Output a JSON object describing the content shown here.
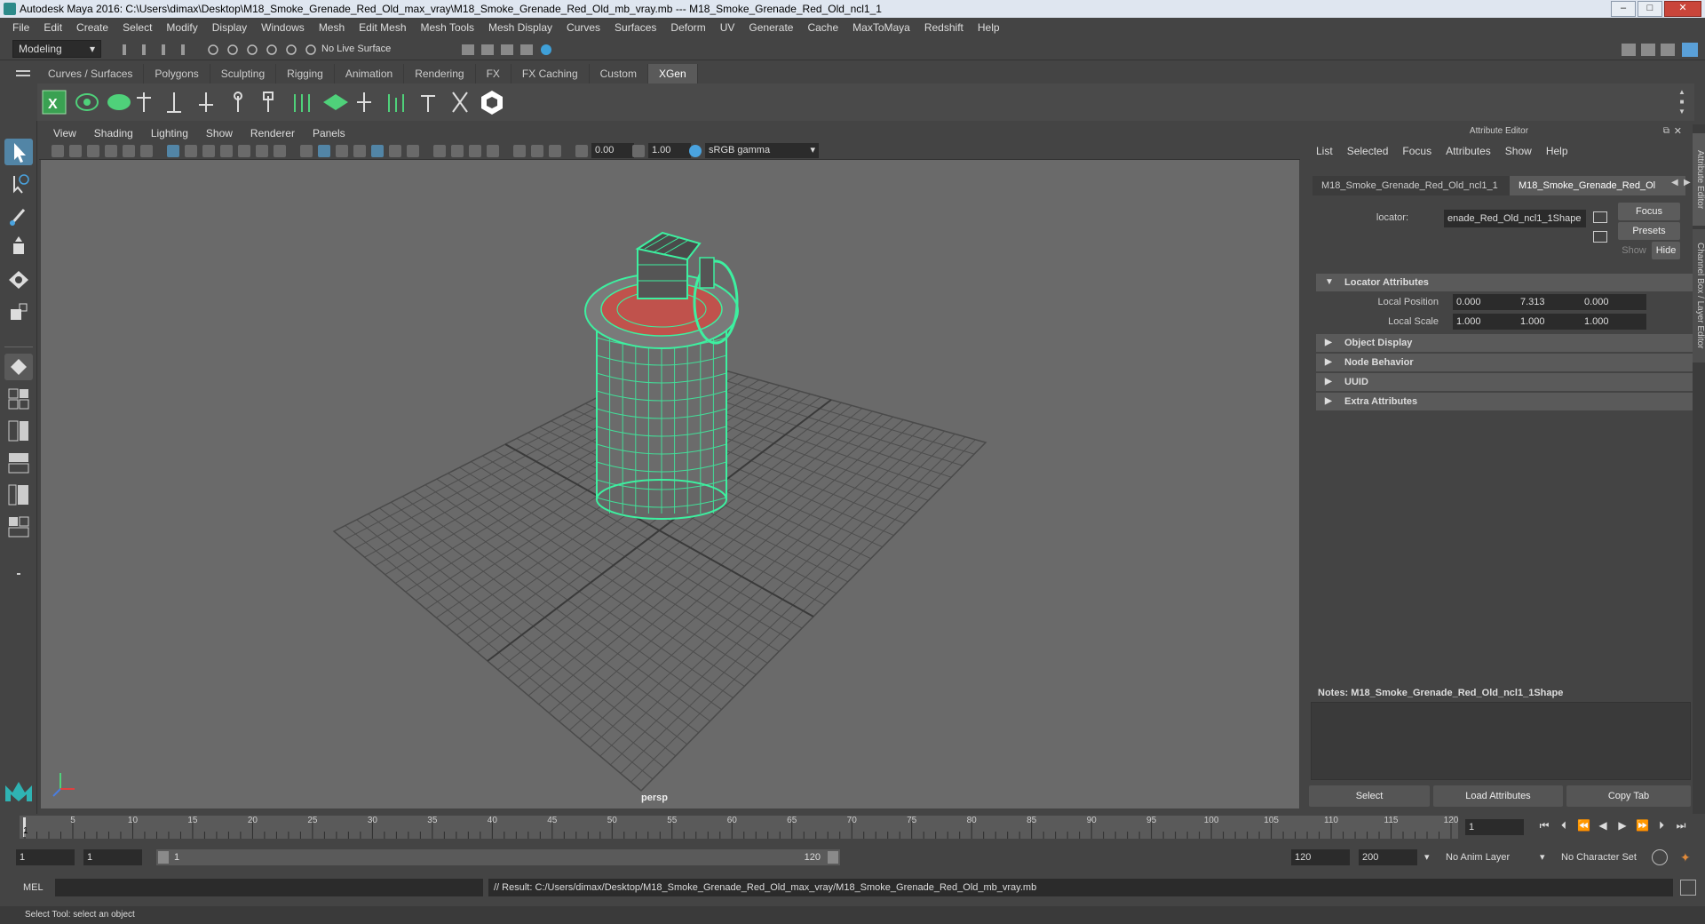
{
  "window": {
    "title": "Autodesk Maya 2016: C:\\Users\\dimax\\Desktop\\M18_Smoke_Grenade_Red_Old_max_vray\\M18_Smoke_Grenade_Red_Old_mb_vray.mb   ---   M18_Smoke_Grenade_Red_Old_ncl1_1",
    "minimize": "–",
    "maximize": "□",
    "close": "✕"
  },
  "menubar": [
    "File",
    "Edit",
    "Create",
    "Select",
    "Modify",
    "Display",
    "Windows",
    "Mesh",
    "Edit Mesh",
    "Mesh Tools",
    "Mesh Display",
    "Curves",
    "Surfaces",
    "Deform",
    "UV",
    "Generate",
    "Cache",
    "MaxToMaya",
    "Redshift",
    "Help"
  ],
  "statusline": {
    "mode": "Modeling",
    "live_surface": "No Live Surface"
  },
  "shelf_tabs": [
    "Curves / Surfaces",
    "Polygons",
    "Sculpting",
    "Rigging",
    "Animation",
    "Rendering",
    "FX",
    "FX Caching",
    "Custom",
    "XGen"
  ],
  "shelf_active": "XGen",
  "viewport": {
    "menu": [
      "View",
      "Shading",
      "Lighting",
      "Show",
      "Renderer",
      "Panels"
    ],
    "exposure": "0.00",
    "gamma": "1.00",
    "colorspace": "sRGB gamma",
    "camera_label": "persp"
  },
  "attribute_editor": {
    "title": "Attribute Editor",
    "menu": [
      "List",
      "Selected",
      "Focus",
      "Attributes",
      "Show",
      "Help"
    ],
    "tabs": [
      "M18_Smoke_Grenade_Red_Old_ncl1_1",
      "M18_Smoke_Grenade_Red_Ol"
    ],
    "locator_label": "locator:",
    "locator_value": "enade_Red_Old_ncl1_1Shape",
    "focus_btn": "Focus",
    "presets_btn": "Presets",
    "show_btn": "Show",
    "hide_btn": "Hide",
    "sections": {
      "locator_attributes": "Locator Attributes",
      "object_display": "Object Display",
      "node_behavior": "Node Behavior",
      "uuid": "UUID",
      "extra_attributes": "Extra Attributes"
    },
    "local_position_label": "Local Position",
    "local_position": [
      "0.000",
      "7.313",
      "0.000"
    ],
    "local_scale_label": "Local Scale",
    "local_scale": [
      "1.000",
      "1.000",
      "1.000"
    ],
    "notes_label": "Notes:  M18_Smoke_Grenade_Red_Old_ncl1_1Shape",
    "bottom_buttons": [
      "Select",
      "Load Attributes",
      "Copy Tab"
    ]
  },
  "side_tabs": [
    "Attribute Editor",
    "Channel Box / Layer Editor"
  ],
  "timeline": {
    "ticks": [
      "5",
      "10",
      "15",
      "20",
      "25",
      "30",
      "35",
      "40",
      "45",
      "50",
      "55",
      "60",
      "65",
      "70",
      "75",
      "80",
      "85",
      "90",
      "95",
      "100",
      "105",
      "110",
      "115",
      "120"
    ],
    "start_marker": "1",
    "current_frame": "1"
  },
  "range": {
    "start": "1",
    "playback_start": "1",
    "slider_start": "1",
    "slider_end": "120",
    "playback_end": "120",
    "end": "200",
    "anim_layer": "No Anim Layer",
    "character_set": "No Character Set"
  },
  "command": {
    "lang": "MEL",
    "result": "// Result: C:/Users/dimax/Desktop/M18_Smoke_Grenade_Red_Old_max_vray/M18_Smoke_Grenade_Red_Old_mb_vray.mb"
  },
  "helpline": "Select Tool: select an object",
  "colors": {
    "wire": "#3df0a0",
    "red": "#c0524c",
    "accent": "#4aa3df"
  }
}
